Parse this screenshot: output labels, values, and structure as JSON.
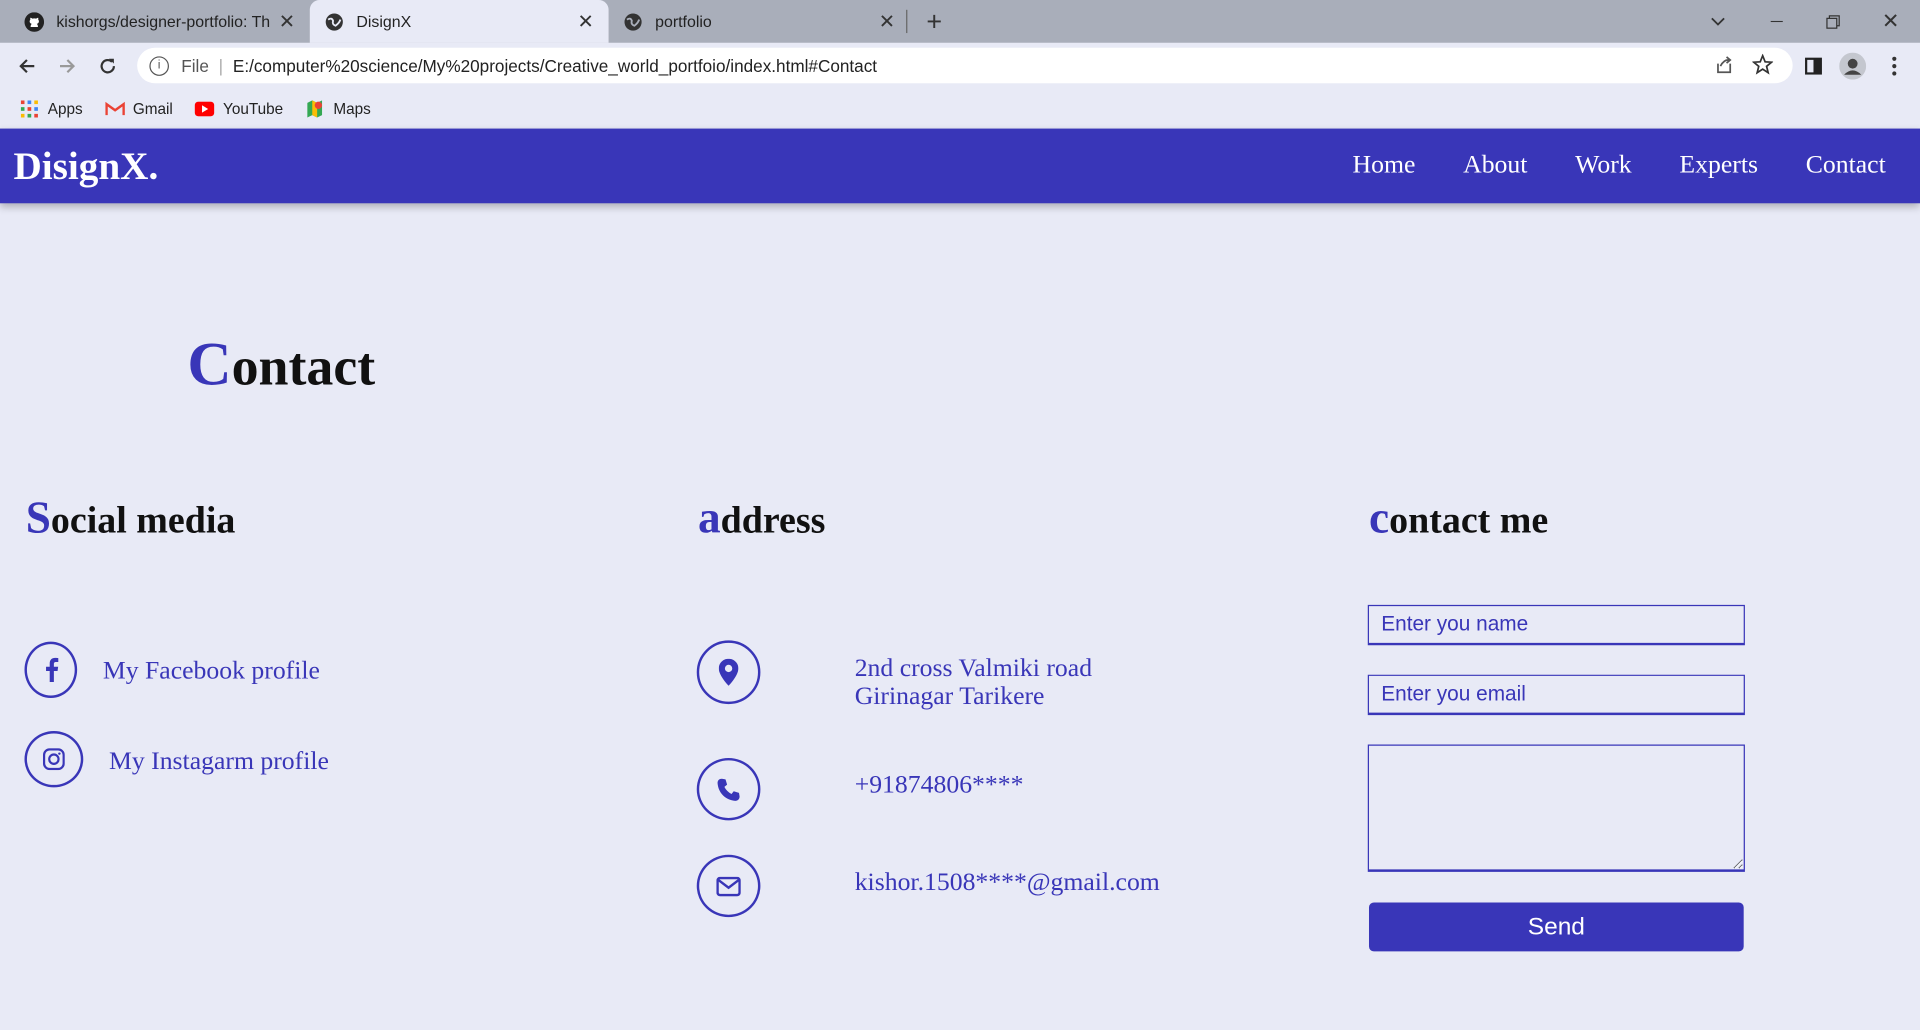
{
  "browser": {
    "tabs": [
      {
        "title": "kishorgs/designer-portfolio: This",
        "icon": "github-icon",
        "active": false
      },
      {
        "title": "DisignX",
        "icon": "globe-icon",
        "active": true
      },
      {
        "title": "portfolio",
        "icon": "globe-icon",
        "active": false
      }
    ],
    "address": {
      "scheme_label": "File",
      "url": "E:/computer%20science/My%20projects/Creative_world_portfoio/index.html#Contact"
    },
    "bookmarks": [
      {
        "label": "Apps",
        "icon": "apps-grid-icon"
      },
      {
        "label": "Gmail",
        "icon": "gmail-icon"
      },
      {
        "label": "YouTube",
        "icon": "youtube-icon"
      },
      {
        "label": "Maps",
        "icon": "maps-icon"
      }
    ]
  },
  "site": {
    "logo": "DisignX.",
    "nav": [
      "Home",
      "About",
      "Work",
      "Experts",
      "Contact"
    ],
    "accent_color": "#3936b8",
    "background_color": "#e8eaf6"
  },
  "contact": {
    "title_initial": "C",
    "title_rest": "ontact",
    "social": {
      "head_initial": "S",
      "head_rest": "ocial media",
      "facebook": "My Facebook profile",
      "instagram": "My Instagarm profile"
    },
    "address": {
      "head_initial": "a",
      "head_rest": "ddress",
      "line1": "2nd cross Valmiki road",
      "line2": "Girinagar Tarikere",
      "phone": "+91874806****",
      "email": "kishor.1508****@gmail.com"
    },
    "form": {
      "head_initial": "c",
      "head_rest": "ontact me",
      "name_placeholder": "Enter you name",
      "email_placeholder": "Enter you email",
      "message_value": "",
      "send_label": "Send"
    }
  }
}
